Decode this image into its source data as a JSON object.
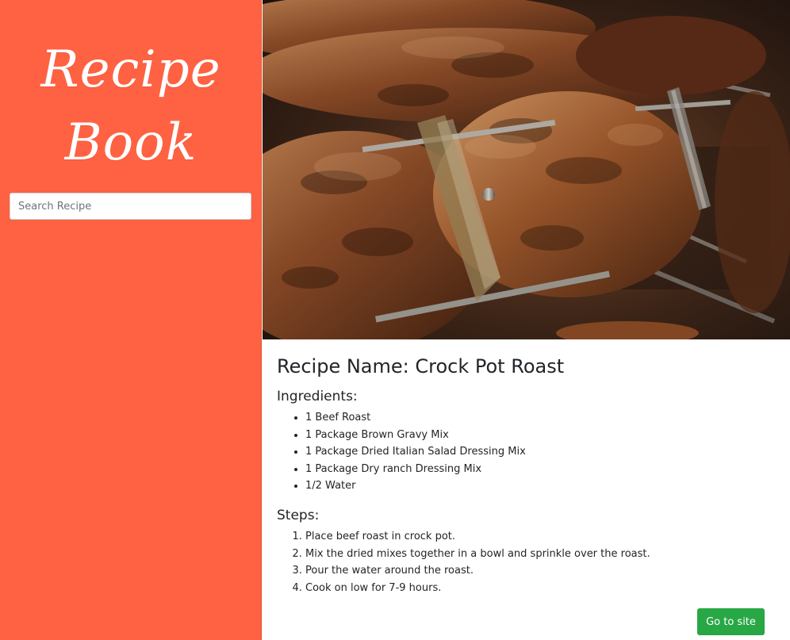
{
  "sidebar": {
    "logo_line1": "Recipe",
    "logo_line2": "Book",
    "search_placeholder": "Search Recipe",
    "background_color": "#ff6242"
  },
  "recipe": {
    "title": "Recipe Name: Crock Pot Roast",
    "ingredients_heading": "Ingredients:",
    "ingredients": [
      "1 Beef Roast",
      "1 Package Brown Gravy Mix",
      "1 Package Dried Italian Salad Dressing Mix",
      "1 Package Dry ranch Dressing Mix",
      "1/2 Water"
    ],
    "steps_heading": "Steps:",
    "steps": [
      "Place beef roast in crock pot.",
      "Mix the dried mixes together in a bowl and sprinkle over the roast.",
      "Pour the water around the roast.",
      "Cook on low for 7-9 hours."
    ]
  },
  "actions": {
    "go_to_site_label": "Go to site",
    "button_color": "#28a745"
  }
}
